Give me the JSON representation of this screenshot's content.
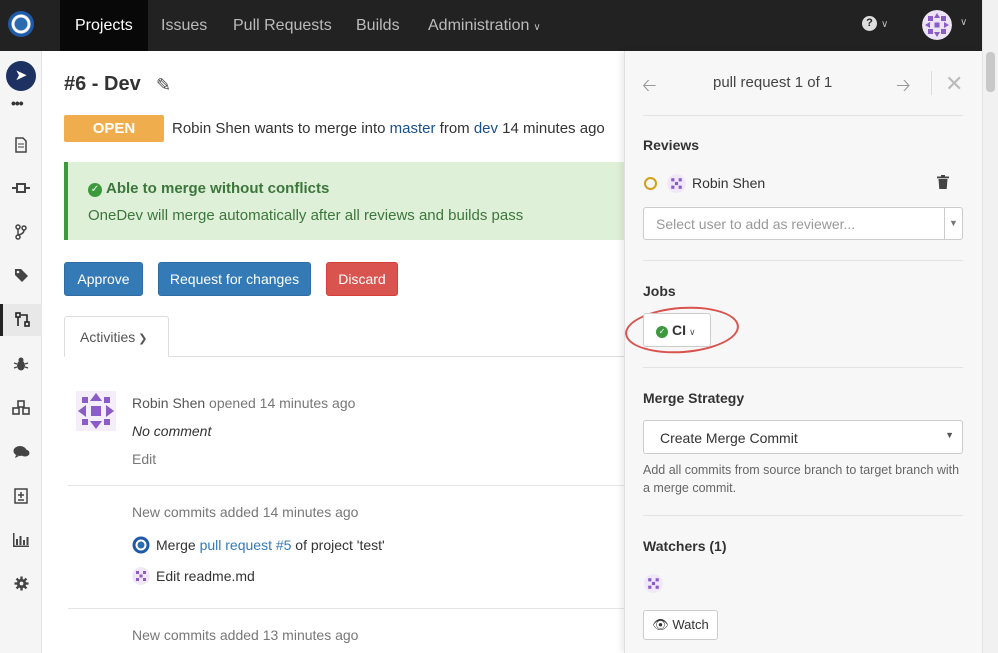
{
  "topnav": {
    "items": [
      "Projects",
      "Issues",
      "Pull Requests",
      "Builds",
      "Administration"
    ],
    "help": "?"
  },
  "request": {
    "title": "#6 - Dev",
    "status": "OPEN",
    "author": "Robin Shen",
    "merge_text_1": " wants to merge into ",
    "target_branch": "master",
    "merge_text_2": " from ",
    "source_branch": "dev",
    "merge_text_3": " 14 minutes ago"
  },
  "merge_status": {
    "title": "Able to merge without conflicts",
    "detail": "OneDev will merge automatically after all reviews and builds pass"
  },
  "actions": {
    "approve": "Approve",
    "request_changes": "Request for changes",
    "discard": "Discard"
  },
  "tabs": {
    "activities": "Activities"
  },
  "activities": {
    "opened_user": "Robin Shen",
    "opened_text": " opened 14 minutes ago",
    "comment": "No comment",
    "edit": "Edit",
    "commits_header_1": "New commits added 14 minutes ago",
    "commit_1_prefix": "Merge ",
    "commit_1_link": "pull request #5",
    "commit_1_suffix": " of project 'test'",
    "commit_2": "Edit readme.md",
    "commits_header_2": "New commits added 13 minutes ago"
  },
  "panel": {
    "title": "pull request 1 of 1",
    "reviews_heading": "Reviews",
    "reviewer": "Robin Shen",
    "reviewer_placeholder": "Select user to add as reviewer...",
    "jobs_heading": "Jobs",
    "job_name": "CI",
    "merge_strategy_heading": "Merge Strategy",
    "merge_strategy_value": "Create Merge Commit",
    "merge_strategy_desc": "Add all commits from source branch to target branch with a merge commit.",
    "watchers_heading": "Watchers (1)",
    "watch_label": "Watch"
  },
  "colors": {
    "topbar": "#222222",
    "primary": "#337ab7",
    "danger": "#d9534f",
    "open": "#f0ad4e",
    "success_bg": "#dff0d8",
    "success_text": "#3c763d"
  }
}
